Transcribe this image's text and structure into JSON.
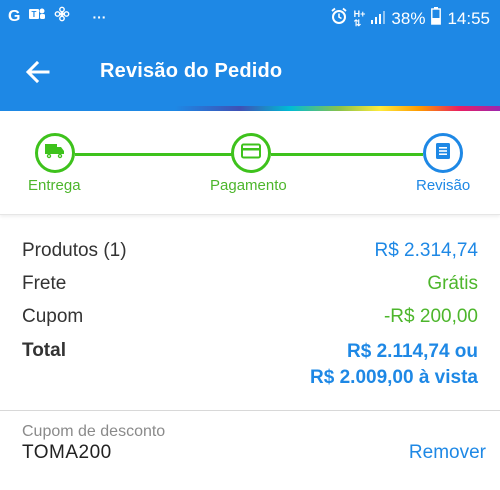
{
  "status_bar": {
    "left_icons": [
      "G",
      "teams-icon",
      "fan-icon"
    ],
    "more": "···",
    "network": "H+",
    "battery": "38%",
    "time": "14:55"
  },
  "header": {
    "title": "Revisão do Pedido"
  },
  "stepper": {
    "steps": [
      {
        "label": "Entrega",
        "icon": "truck-icon",
        "state": "done",
        "color": "#3ec21c"
      },
      {
        "label": "Pagamento",
        "icon": "card-icon",
        "state": "done",
        "color": "#3ec21c"
      },
      {
        "label": "Revisão",
        "icon": "list-icon",
        "state": "current",
        "color": "#1e88e5"
      }
    ]
  },
  "summary": {
    "products_label": "Produtos (1)",
    "products_value": "R$ 2.314,74",
    "shipping_label": "Frete",
    "shipping_value": "Grátis",
    "coupon_label": "Cupom",
    "coupon_value": "-R$ 200,00",
    "total_label": "Total",
    "total_value_line1": "R$ 2.114,74 ou",
    "total_value_line2": "R$ 2.009,00 à vista"
  },
  "discount": {
    "label": "Cupom de desconto",
    "code": "TOMA200",
    "remove_label": "Remover"
  },
  "colors": {
    "primary": "#1e88e5",
    "success": "#3ec21c",
    "text": "#333333"
  }
}
